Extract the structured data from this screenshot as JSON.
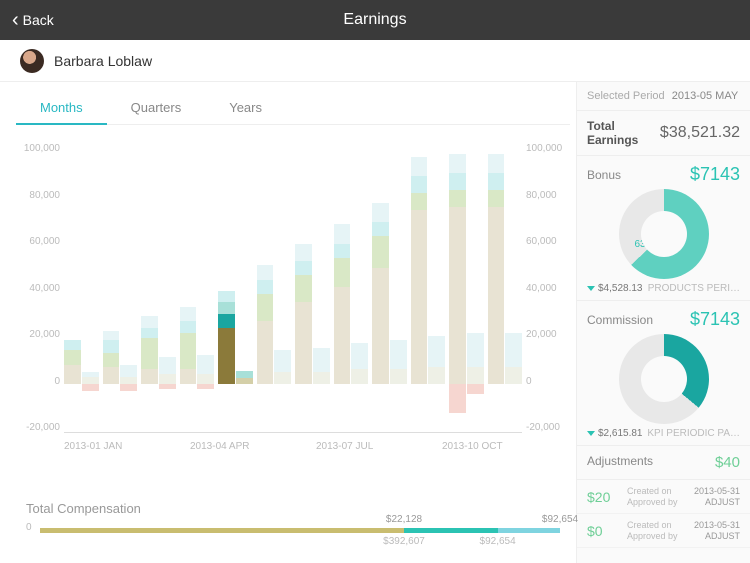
{
  "nav": {
    "back": "Back",
    "title": "Earnings"
  },
  "user": {
    "name": "Barbara Loblaw"
  },
  "tabs": {
    "months": "Months",
    "quarters": "Quarters",
    "years": "Years",
    "active": "months"
  },
  "chart": {
    "y_ticks": [
      "100,000",
      "80,000",
      "60,000",
      "40,000",
      "20,000",
      "0",
      "-20,000"
    ],
    "x_ticks": [
      "2013-01 JAN",
      "2013-04 APR",
      "2013-07 JUL",
      "2013-10 OCT"
    ]
  },
  "chart_data": {
    "type": "bar",
    "ylim": [
      -20000,
      100000
    ],
    "categories": [
      "2013-01",
      "2013-02",
      "2013-03",
      "2013-04",
      "2013-05",
      "2013-06",
      "2013-07",
      "2013-08",
      "2013-09",
      "2013-10",
      "2013-11",
      "2013-12"
    ],
    "selected_index": 4,
    "series": [
      {
        "name": "left-stack",
        "stacks": [
          [
            {
              "v": 8000,
              "c": "#e8e3d3"
            },
            {
              "v": 6000,
              "c": "#d9e8c6"
            },
            {
              "v": 4000,
              "c": "#cfeff0"
            }
          ],
          [
            {
              "v": 7000,
              "c": "#e8e3d3"
            },
            {
              "v": 6000,
              "c": "#d9e8c6"
            },
            {
              "v": 5000,
              "c": "#cfeff0"
            },
            {
              "v": 4000,
              "c": "#e6f4f6"
            }
          ],
          [
            {
              "v": 6000,
              "c": "#e8e3d3"
            },
            {
              "v": 13000,
              "c": "#d9e8c6"
            },
            {
              "v": 4000,
              "c": "#cfeff0"
            },
            {
              "v": 5000,
              "c": "#e6f4f6"
            }
          ],
          [
            {
              "v": 6000,
              "c": "#e8e3d3"
            },
            {
              "v": 15000,
              "c": "#d9e8c6"
            },
            {
              "v": 5000,
              "c": "#cfeff0"
            },
            {
              "v": 6000,
              "c": "#e6f4f6"
            }
          ],
          [
            {
              "v": 23000,
              "c": "#8b7a3a"
            },
            {
              "v": 6000,
              "c": "#1aa6a0"
            },
            {
              "v": 5000,
              "c": "#a8e0d8"
            },
            {
              "v": 4500,
              "c": "#cfeff0"
            }
          ],
          [
            {
              "v": 26000,
              "c": "#e8e3d3"
            },
            {
              "v": 11000,
              "c": "#d9e8c6"
            },
            {
              "v": 6000,
              "c": "#cfeff0"
            },
            {
              "v": 6000,
              "c": "#e6f4f6"
            }
          ],
          [
            {
              "v": 34000,
              "c": "#e8e3d3"
            },
            {
              "v": 11000,
              "c": "#d9e8c6"
            },
            {
              "v": 6000,
              "c": "#cfeff0"
            },
            {
              "v": 7000,
              "c": "#e6f4f6"
            }
          ],
          [
            {
              "v": 40000,
              "c": "#e8e3d3"
            },
            {
              "v": 12000,
              "c": "#d9e8c6"
            },
            {
              "v": 6000,
              "c": "#cfeff0"
            },
            {
              "v": 8000,
              "c": "#e6f4f6"
            }
          ],
          [
            {
              "v": 48000,
              "c": "#e8e3d3"
            },
            {
              "v": 13000,
              "c": "#d9e8c6"
            },
            {
              "v": 6000,
              "c": "#cfeff0"
            },
            {
              "v": 8000,
              "c": "#e6f4f6"
            }
          ],
          [
            {
              "v": 72000,
              "c": "#e8e3d3"
            },
            {
              "v": 7000,
              "c": "#d9e8c6"
            },
            {
              "v": 7000,
              "c": "#cfeff0"
            },
            {
              "v": 8000,
              "c": "#e6f4f6"
            }
          ],
          [
            {
              "v": 73000,
              "c": "#e8e3d3"
            },
            {
              "v": 7000,
              "c": "#d9e8c6"
            },
            {
              "v": 7000,
              "c": "#cfeff0"
            },
            {
              "v": 8000,
              "c": "#e6f4f6"
            }
          ],
          [
            {
              "v": 73000,
              "c": "#e8e3d3"
            },
            {
              "v": 7000,
              "c": "#d9e8c6"
            },
            {
              "v": 7000,
              "c": "#cfeff0"
            },
            {
              "v": 8000,
              "c": "#e6f4f6"
            }
          ]
        ],
        "neg": [
          0,
          0,
          0,
          0,
          0,
          0,
          0,
          0,
          0,
          0,
          -12000,
          0
        ]
      },
      {
        "name": "right-stack",
        "stacks": [
          [
            {
              "v": 3000,
              "c": "#eef0e6"
            },
            {
              "v": 2000,
              "c": "#e6f4f6"
            }
          ],
          [
            {
              "v": 3000,
              "c": "#eef0e6"
            },
            {
              "v": 5000,
              "c": "#e6f4f6"
            }
          ],
          [
            {
              "v": 4000,
              "c": "#eef0e6"
            },
            {
              "v": 7000,
              "c": "#e6f4f6"
            }
          ],
          [
            {
              "v": 4000,
              "c": "#eef0e6"
            },
            {
              "v": 8000,
              "c": "#e6f4f6"
            }
          ],
          [
            {
              "v": 2500,
              "c": "#d4cfa8"
            },
            {
              "v": 3000,
              "c": "#a8e0d8"
            }
          ],
          [
            {
              "v": 5000,
              "c": "#eef0e6"
            },
            {
              "v": 9000,
              "c": "#e6f4f6"
            }
          ],
          [
            {
              "v": 5000,
              "c": "#eef0e6"
            },
            {
              "v": 10000,
              "c": "#e6f4f6"
            }
          ],
          [
            {
              "v": 6000,
              "c": "#eef0e6"
            },
            {
              "v": 11000,
              "c": "#e6f4f6"
            }
          ],
          [
            {
              "v": 6000,
              "c": "#eef0e6"
            },
            {
              "v": 12000,
              "c": "#e6f4f6"
            }
          ],
          [
            {
              "v": 7000,
              "c": "#eef0e6"
            },
            {
              "v": 13000,
              "c": "#e6f4f6"
            }
          ],
          [
            {
              "v": 7000,
              "c": "#eef0e6"
            },
            {
              "v": 14000,
              "c": "#e6f4f6"
            }
          ],
          [
            {
              "v": 7000,
              "c": "#eef0e6"
            },
            {
              "v": 14000,
              "c": "#e6f4f6"
            }
          ]
        ],
        "neg": [
          -3000,
          -3000,
          -2000,
          -2000,
          0,
          0,
          0,
          0,
          0,
          0,
          -4000,
          0
        ]
      }
    ]
  },
  "total_comp": {
    "title": "Total Compensation",
    "zero": "0",
    "segments": [
      {
        "color": "#c9bd70",
        "pct": 70,
        "top_label": "$22,128",
        "bot_label": "$392,607"
      },
      {
        "color": "#2bc3b3",
        "pct": 18,
        "top_label": "",
        "bot_label": "$92,654"
      },
      {
        "color": "#7fd4e0",
        "pct": 12,
        "top_label": "$92,654",
        "bot_label": ""
      }
    ]
  },
  "sidebar": {
    "selected_label": "Selected Period",
    "selected_value": "2013-05 MAY",
    "total_label": "Total Earnings",
    "total_value": "$38,521.32",
    "bonus": {
      "label": "Bonus",
      "amount": "$7143",
      "pct": "63%",
      "pct_num": 63,
      "delta": "$4,528.13",
      "caption": "PRODUCTS PERI…"
    },
    "commission": {
      "label": "Commission",
      "amount": "$7143",
      "pct": "36%",
      "pct_num": 36,
      "delta": "$2,615.81",
      "caption": "KPI PERIODIC PA…"
    },
    "adjustments": {
      "label": "Adjustments",
      "amount": "$40",
      "rows": [
        {
          "amt": "$20",
          "created_lbl": "Created on",
          "created_val": "2013-05-31",
          "approved_lbl": "Approved by",
          "approved_val": "ADJUST"
        },
        {
          "amt": "$0",
          "created_lbl": "Created on",
          "created_val": "2013-05-31",
          "approved_lbl": "Approved by",
          "approved_val": "ADJUST"
        }
      ]
    }
  }
}
